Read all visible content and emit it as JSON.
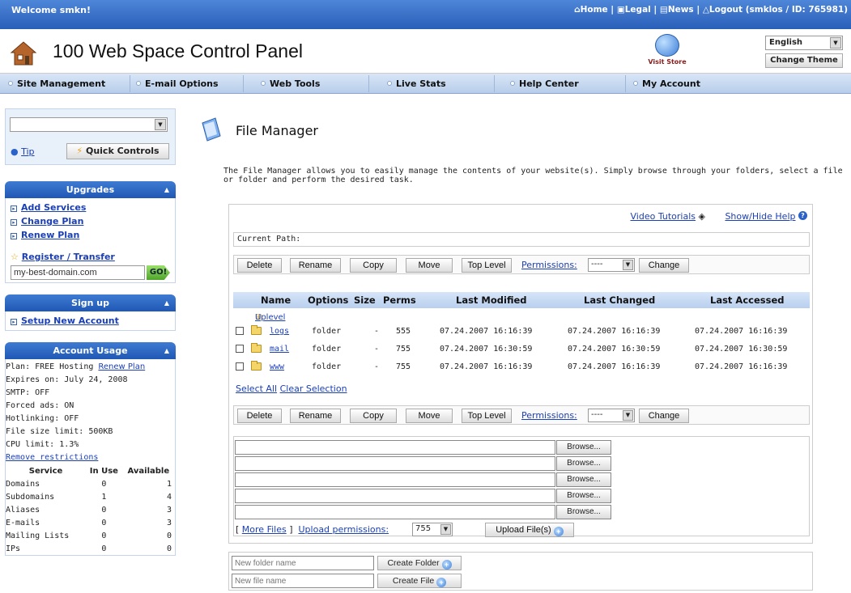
{
  "topbar": {
    "welcome": "Welcome smkn!",
    "home": "Home",
    "legal": "Legal",
    "news": "News",
    "logout": "Logout (smklos / ID: 765981)"
  },
  "header": {
    "title": "100 Web Space Control Panel",
    "visit_store": "Visit Store",
    "language": "English",
    "change_theme": "Change Theme"
  },
  "nav": [
    "Site Management",
    "E-mail Options",
    "Web Tools",
    "Live Stats",
    "Help Center",
    "My Account"
  ],
  "left": {
    "tip": "Tip",
    "quick_controls": "Quick Controls",
    "upgrades": {
      "title": "Upgrades",
      "items": [
        "Add Services",
        "Change Plan",
        "Renew Plan"
      ],
      "register": "Register / Transfer",
      "domain_value": "my-best-domain.com",
      "go": "GO!"
    },
    "signup": {
      "title": "Sign up",
      "items": [
        "Setup New Account"
      ]
    },
    "usage": {
      "title": "Account Usage",
      "plan": "Plan: FREE Hosting",
      "renew": "Renew Plan",
      "lines": [
        "Expires on: July 24, 2008",
        "SMTP: OFF",
        "Forced ads: ON",
        "Hotlinking: OFF",
        "File size limit: 500KB",
        "CPU limit: 1.3%"
      ],
      "remove": "Remove restrictions",
      "columns": [
        "Service",
        "In Use",
        "Available"
      ],
      "rows": [
        [
          "Domains",
          "0",
          "1"
        ],
        [
          "Subdomains",
          "1",
          "4"
        ],
        [
          "Aliases",
          "0",
          "3"
        ],
        [
          "E-mails",
          "0",
          "3"
        ],
        [
          "Mailing Lists",
          "0",
          "0"
        ],
        [
          "IPs",
          "0",
          "0"
        ]
      ]
    }
  },
  "main": {
    "title": "File Manager",
    "description": "The File Manager allows you to easily manage the contents of your website(s). Simply browse through your folders, select a file or folder and perform the desired task.",
    "video_tutorials": "Video Tutorials",
    "show_hide_help": "Show/Hide Help",
    "current_path": "Current Path:",
    "actions": {
      "delete": "Delete",
      "rename": "Rename",
      "copy": "Copy",
      "move": "Move",
      "top_level": "Top Level",
      "permissions": "Permissions:",
      "perm_value": "----",
      "change": "Change"
    },
    "columns": [
      "Name",
      "Options",
      "Size",
      "Perms",
      "Last Modified",
      "Last Changed",
      "Last Accessed"
    ],
    "uplevel": "Uplevel",
    "files": [
      {
        "name": "logs",
        "type": "folder",
        "size": "-",
        "perms": "555",
        "modified": "07.24.2007 16:16:39",
        "changed": "07.24.2007 16:16:39",
        "accessed": "07.24.2007 16:16:39"
      },
      {
        "name": "mail",
        "type": "folder",
        "size": "-",
        "perms": "755",
        "modified": "07.24.2007 16:30:59",
        "changed": "07.24.2007 16:30:59",
        "accessed": "07.24.2007 16:30:59"
      },
      {
        "name": "www",
        "type": "folder",
        "size": "-",
        "perms": "755",
        "modified": "07.24.2007 16:16:39",
        "changed": "07.24.2007 16:16:39",
        "accessed": "07.24.2007 16:16:39"
      }
    ],
    "select_all": "Select All",
    "clear_selection": "Clear Selection",
    "browse": "Browse...",
    "more_files": "More Files",
    "upload_permissions": "Upload permissions:",
    "upload_perm_value": "755",
    "upload_files": "Upload File(s)",
    "new_folder_placeholder": "New folder name",
    "create_folder": "Create Folder",
    "new_file_placeholder": "New file name",
    "create_file": "Create File"
  },
  "colors": {
    "topbar": "#2a5fb8",
    "panel_head": "#1f58b5",
    "link": "#1b3fb5"
  }
}
